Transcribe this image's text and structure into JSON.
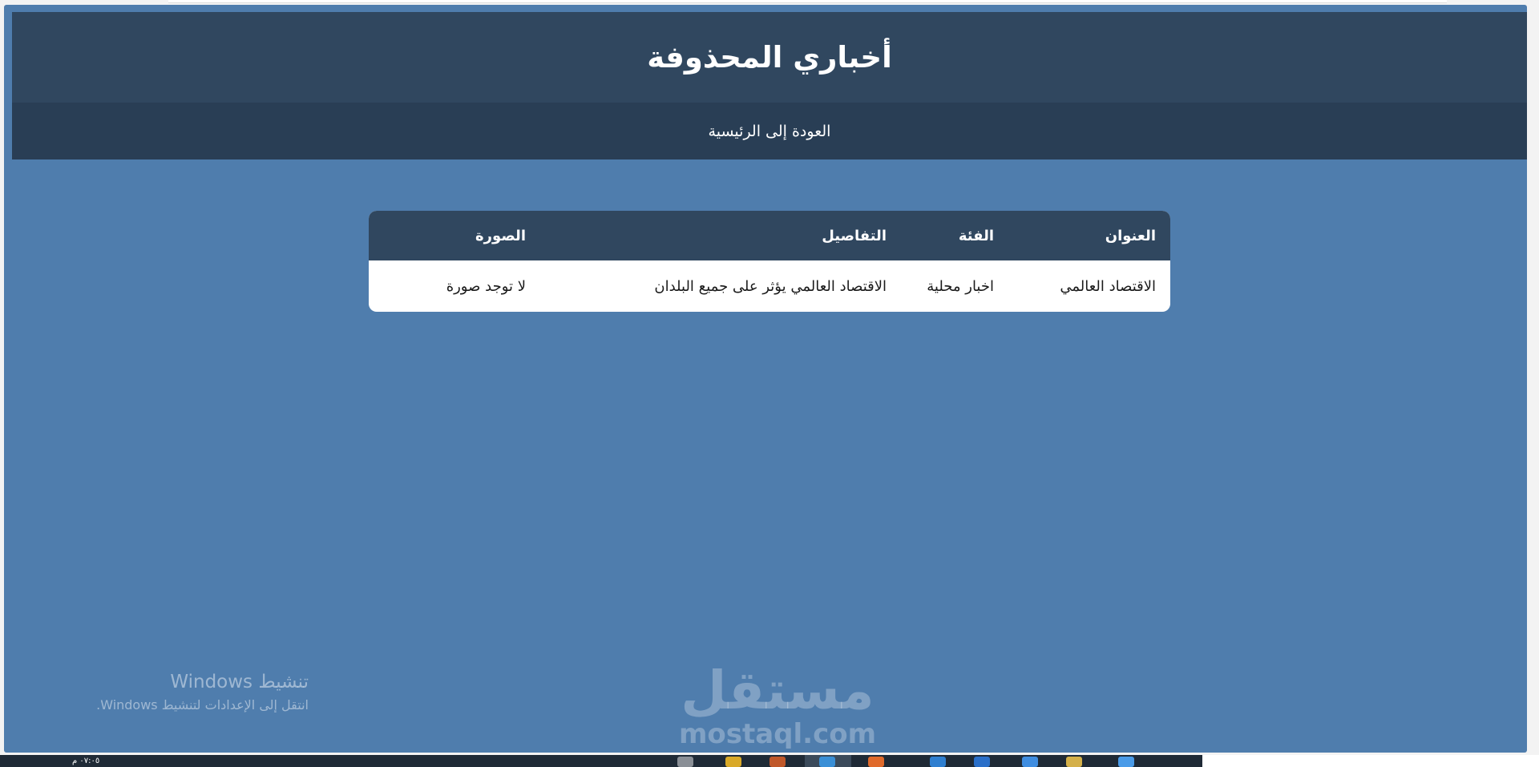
{
  "header": {
    "title": "أخباري المحذوفة"
  },
  "nav": {
    "back_home": "العودة إلى الرئيسية"
  },
  "table": {
    "columns": [
      "العنوان",
      "الفئة",
      "التفاصيل",
      "الصورة"
    ],
    "rows": [
      [
        "الاقتصاد العالمي",
        "اخبار محلية",
        "الاقتصاد العالمي يؤثر على جميع البلدان",
        "لا توجد صورة"
      ]
    ]
  },
  "watermark": {
    "line1": "تنشيط Windows",
    "line2": "انتقل إلى الإعدادات لتنشيط Windows."
  },
  "logo": {
    "arabic": "مستقل",
    "latin": "mostaql.com"
  },
  "taskbar": {
    "clock": "٠٧:٠٥ م"
  },
  "colors": {
    "page_background": "#4f7dad",
    "header_background": "#30475f",
    "nav_background": "#293e55"
  }
}
